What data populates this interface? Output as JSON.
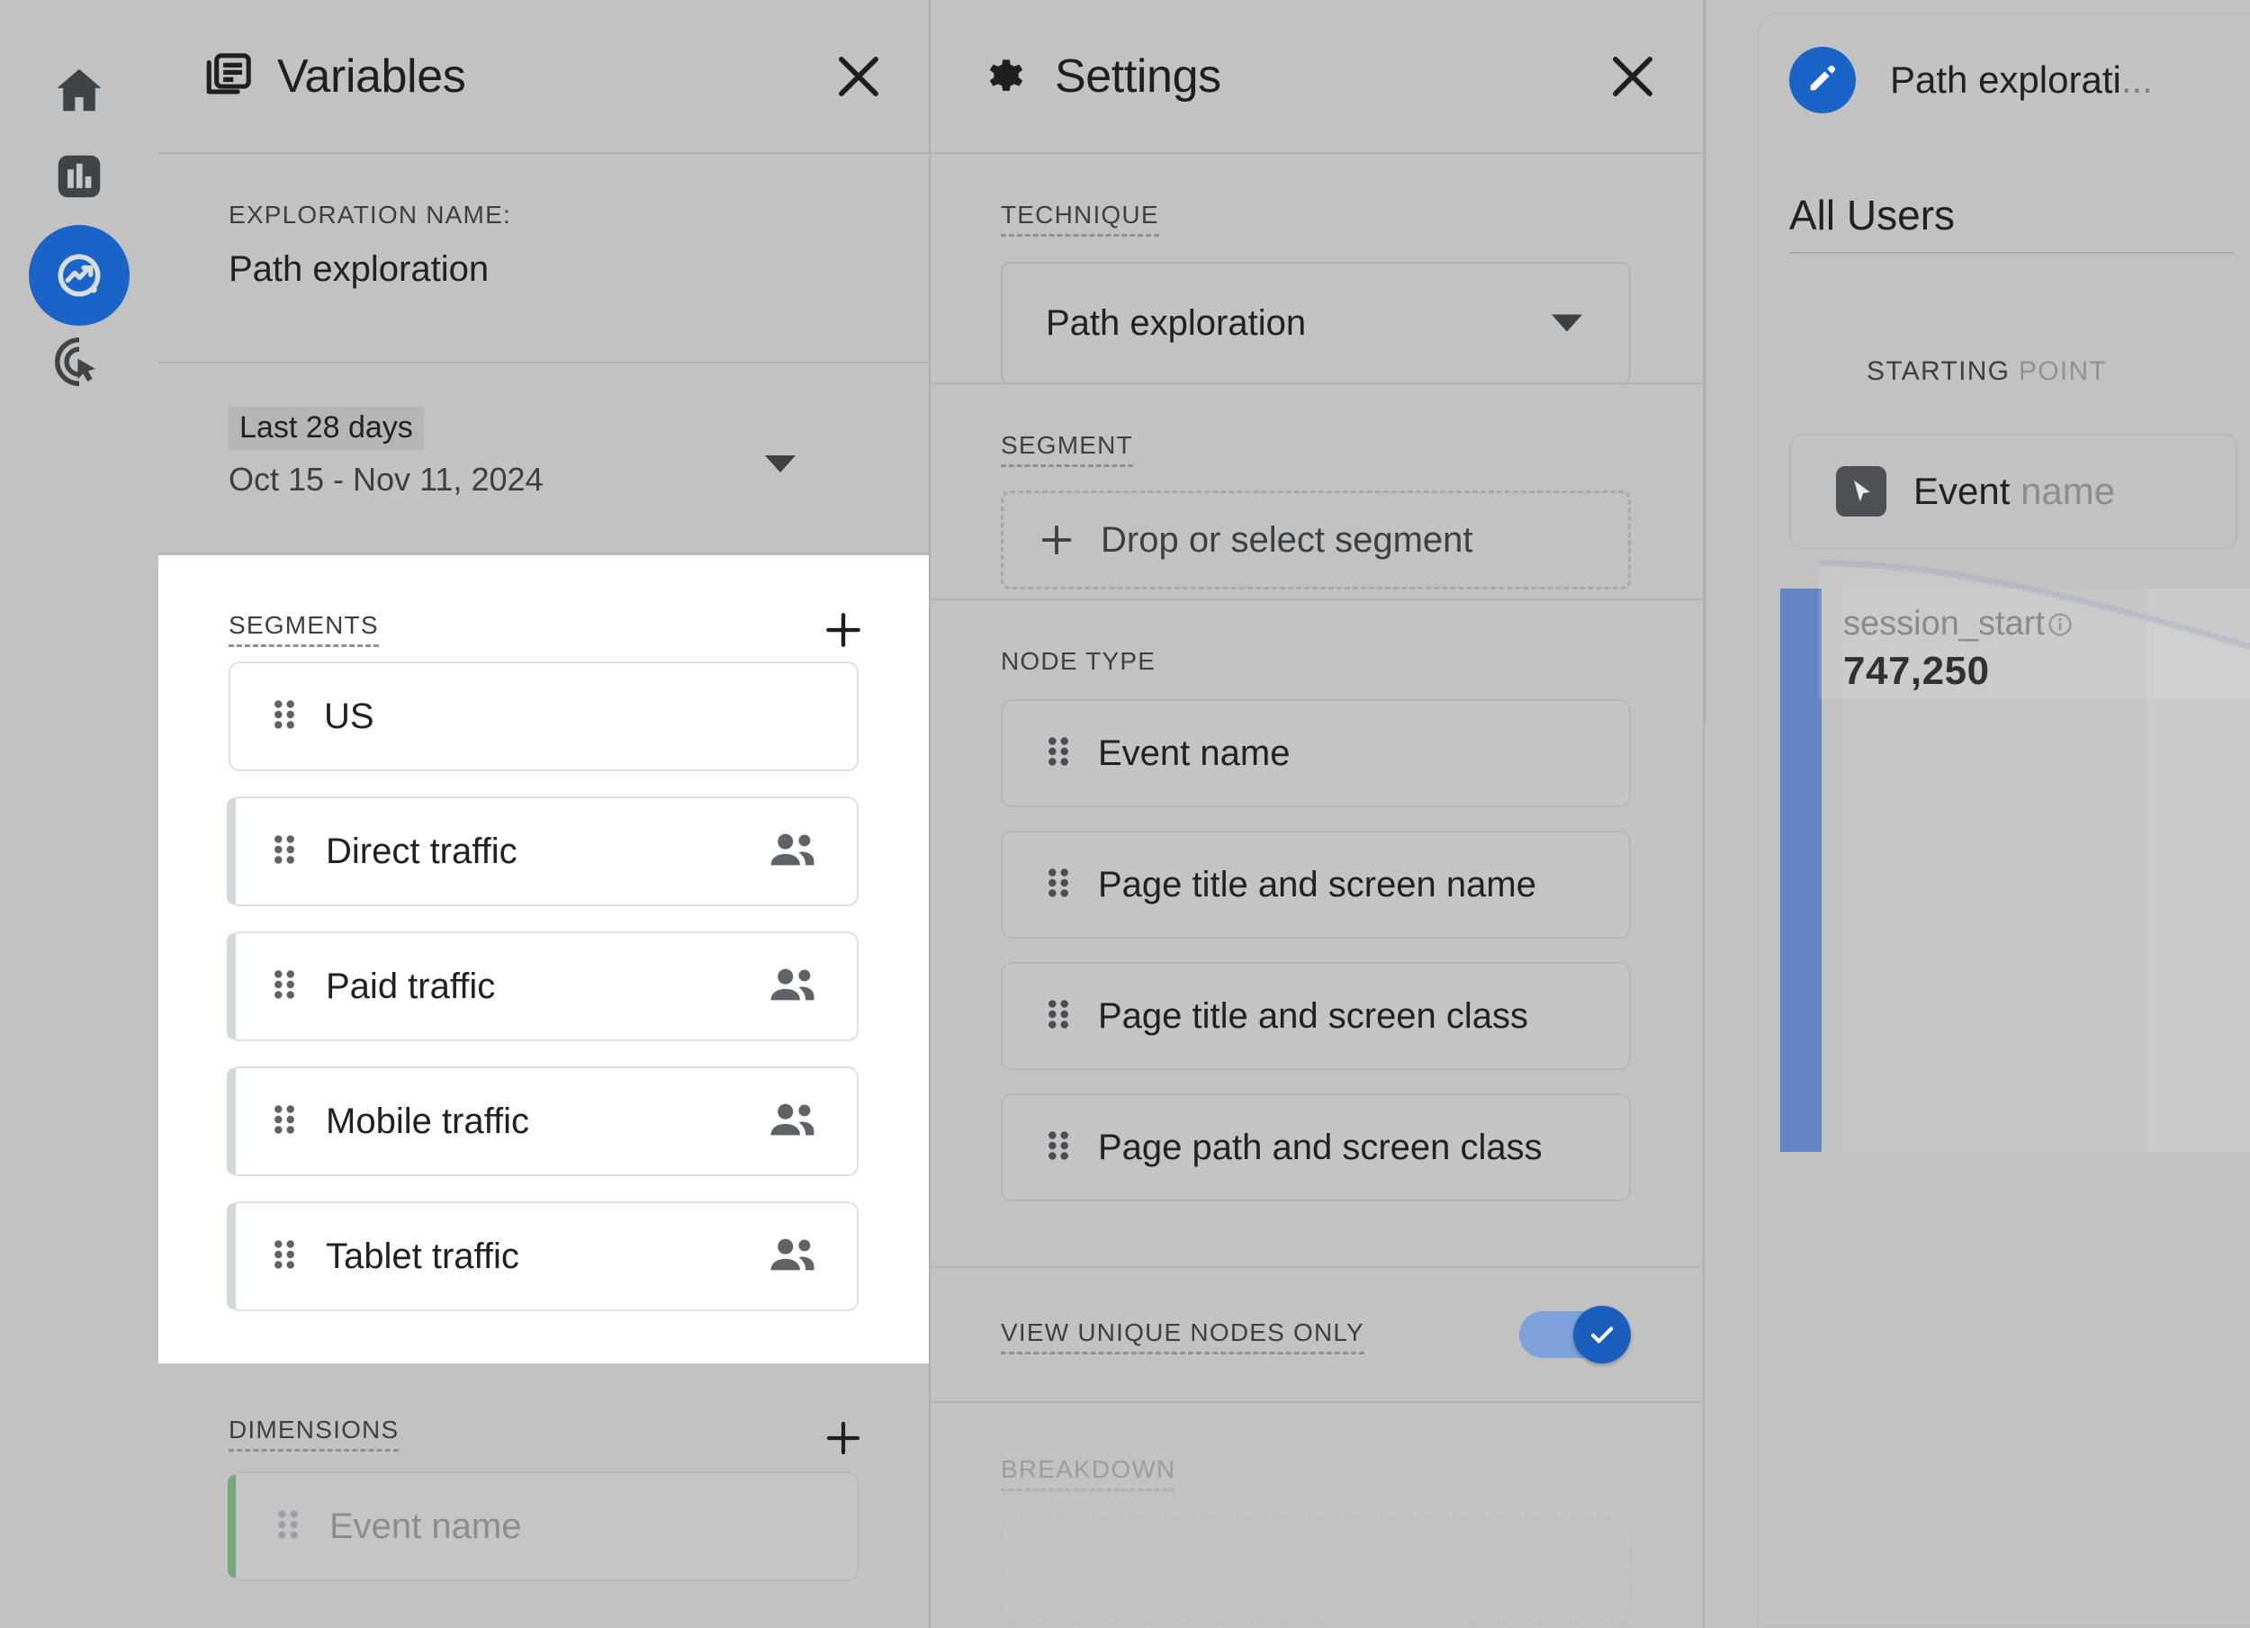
{
  "rail": {
    "items": [
      {
        "name": "home",
        "label": "Home",
        "active": false
      },
      {
        "name": "reports",
        "label": "Reports",
        "active": false
      },
      {
        "name": "explore",
        "label": "Explore",
        "active": true
      },
      {
        "name": "advertising",
        "label": "Advertising",
        "active": false
      }
    ],
    "active_color": "#1a63c7"
  },
  "variables": {
    "title": "Variables",
    "icon": "variables-icon",
    "close_label": "×",
    "exploration_caption": "EXPLORATION NAME:",
    "exploration_name": "Path exploration",
    "date_chip": "Last 28 days",
    "date_range": "Oct 15 - Nov 11, 2024",
    "segments": {
      "caption": "SEGMENTS",
      "add_label": "+",
      "items": [
        {
          "label": "US",
          "has_person_icon": false
        },
        {
          "label": "Direct traffic",
          "has_person_icon": true
        },
        {
          "label": "Paid traffic",
          "has_person_icon": true
        },
        {
          "label": "Mobile traffic",
          "has_person_icon": true
        },
        {
          "label": "Tablet traffic",
          "has_person_icon": true
        }
      ]
    },
    "dimensions": {
      "caption": "DIMENSIONS",
      "add_label": "+",
      "items": [
        {
          "label": "Event name"
        }
      ]
    }
  },
  "settings": {
    "title": "Settings",
    "icon": "gear-icon",
    "close_label": "×",
    "technique": {
      "caption": "TECHNIQUE",
      "selected": "Path exploration"
    },
    "segment": {
      "caption": "SEGMENT",
      "dropzone_label": "Drop or select segment",
      "dropzone_plus": "+"
    },
    "node_type": {
      "caption": "NODE TYPE",
      "items": [
        {
          "label": "Event name"
        },
        {
          "label": "Page title and screen name"
        },
        {
          "label": "Page title and screen class"
        },
        {
          "label": "Page path and screen class"
        }
      ]
    },
    "view_unique_nodes": {
      "caption": "VIEW UNIQUE NODES ONLY",
      "enabled": true,
      "on_color": "#1a5fbd",
      "track_color": "#7da2db"
    },
    "breakdown": {
      "caption": "BREAKDOWN"
    }
  },
  "canvas": {
    "report_title": "Path explorati",
    "report_title_ellipsis": "...",
    "edit_icon": "pencil-icon",
    "metric_label": "All Users",
    "starting_point_caption_bold": "STARTING",
    "starting_point_caption_faded": " POINT",
    "start_node": {
      "icon": "cursor-select-icon",
      "label_strong": "Event",
      "label_faded": " name"
    },
    "node": {
      "name": "session_start",
      "info_icon": "info-icon",
      "value": "747,250"
    },
    "bar_color": "#6485c4"
  },
  "chart_data": {
    "type": "bar",
    "title": "Path exploration — All Users",
    "categories": [
      "session_start"
    ],
    "values": [
      747250
    ],
    "value_labels": [
      "747,250"
    ],
    "xlabel": "STARTING POINT",
    "ylabel": "All Users",
    "legend": [],
    "grid": false,
    "series": [
      {
        "name": "All Users",
        "values": [
          747250
        ]
      }
    ]
  }
}
